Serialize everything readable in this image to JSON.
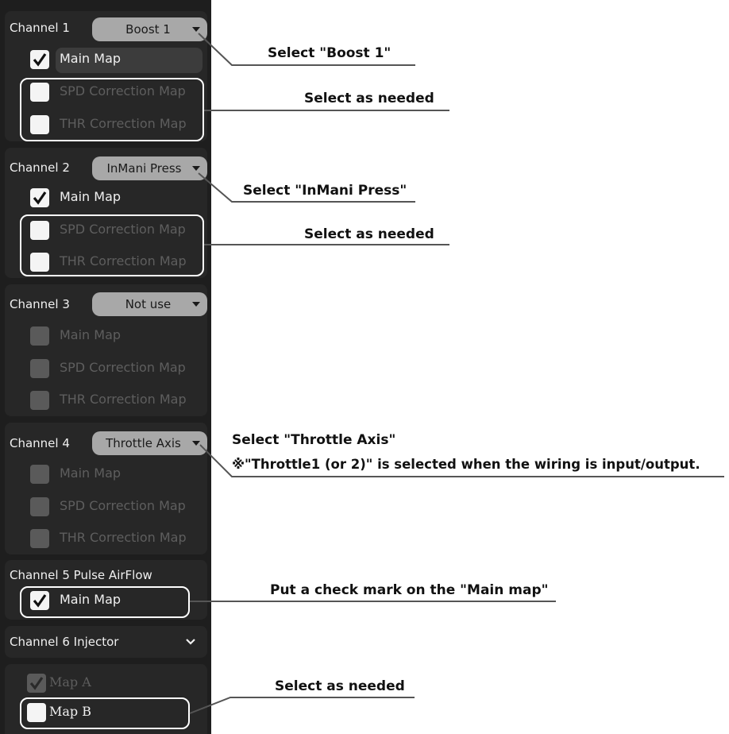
{
  "channels": {
    "ch1": {
      "label": "Channel 1",
      "dropdown": "Boost 1",
      "main": "Main Map",
      "spd": "SPD Correction Map",
      "thr": "THR Correction Map"
    },
    "ch2": {
      "label": "Channel 2",
      "dropdown": "InMani Press",
      "main": "Main Map",
      "spd": "SPD Correction Map",
      "thr": "THR Correction Map"
    },
    "ch3": {
      "label": "Channel 3",
      "dropdown": "Not use",
      "main": "Main Map",
      "spd": "SPD Correction Map",
      "thr": "THR Correction Map"
    },
    "ch4": {
      "label": "Channel 4",
      "dropdown": "Throttle Axis",
      "main": "Main Map",
      "spd": "SPD Correction Map",
      "thr": "THR Correction Map"
    },
    "ch5": {
      "label": "Channel 5 Pulse AirFlow",
      "main": "Main Map"
    },
    "ch6": {
      "label": "Channel 6 Injector",
      "map_a": "Map A",
      "map_b": "Map B"
    }
  },
  "notes": {
    "n1": "Select \"Boost 1\"",
    "n2": "Select as needed",
    "n3": "Select \"InMani Press\"",
    "n4": "Select as needed",
    "n5": "Select \"Throttle Axis\"",
    "n5b": "※\"Throttle1 (or 2)\" is selected when the wiring is input/output.",
    "n6": "Put a check mark on the \"Main map\"",
    "n7": "Select as needed"
  },
  "checkbox_states": {
    "ch1_main": true,
    "ch1_spd": false,
    "ch1_thr": false,
    "ch2_main": true,
    "ch2_spd": false,
    "ch2_thr": false,
    "ch3_main": false,
    "ch3_spd": false,
    "ch3_thr": false,
    "ch4_main": false,
    "ch4_spd": false,
    "ch4_thr": false,
    "ch5_main": true,
    "ch6_map_a": true,
    "ch6_map_b": false
  },
  "colors": {
    "panel": "#1e1e1e",
    "group": "#272727",
    "dropdown": "#a8a8a8",
    "highlight": "#ffffff",
    "disabled": "#5a5a5a"
  }
}
